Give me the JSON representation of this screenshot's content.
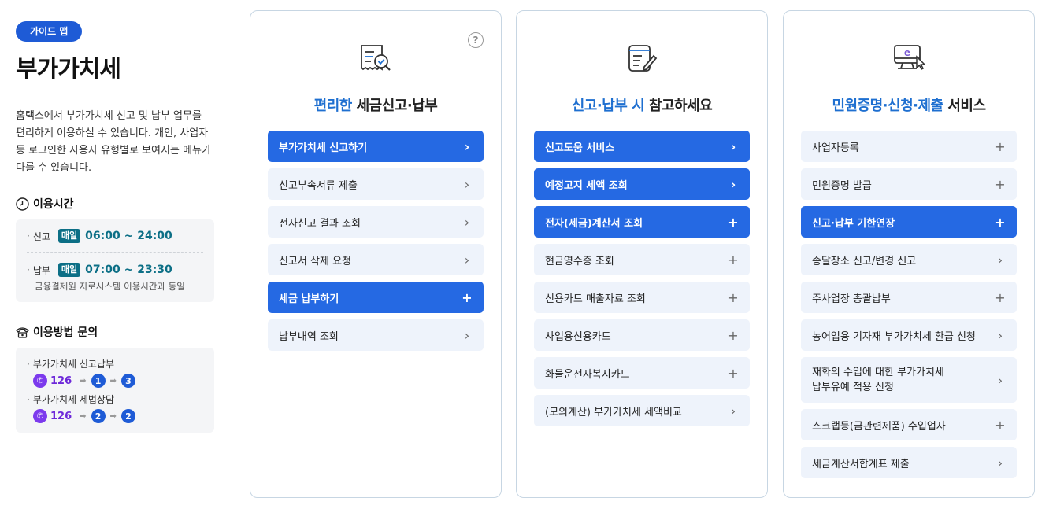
{
  "left": {
    "badge": "가이드 맵",
    "title": "부가가치세",
    "description": "홈택스에서 부가가치세 신고 및 납부 업무를 편리하게 이용하실 수 있습니다. 개인, 사업자 등 로그인한 사용자 유형별로 보여지는 메뉴가 다를 수 있습니다.",
    "hours": {
      "title": "이용시간",
      "report_label": "신고",
      "report_badge": "매일",
      "report_time": "06:00 ~ 24:00",
      "pay_label": "납부",
      "pay_badge": "매일",
      "pay_time": "07:00 ~ 23:30",
      "pay_note": "금융결제원 지로시스템 이용시간과 동일"
    },
    "inquiry": {
      "title": "이용방법 문의",
      "items": [
        {
          "label": "부가가치세 신고납부",
          "phone": "126",
          "step1": "1",
          "step2": "3"
        },
        {
          "label": "부가가치세 세법상담",
          "phone": "126",
          "step1": "2",
          "step2": "2"
        }
      ]
    }
  },
  "cards": [
    {
      "title_accent": "편리한",
      "title_rest": " 세금신고·납부",
      "items": [
        {
          "label": "부가가치세 신고하기",
          "icon": "chevron-right",
          "active": true
        },
        {
          "label": "신고부속서류 제출",
          "icon": "chevron-right",
          "active": false
        },
        {
          "label": "전자신고 결과 조회",
          "icon": "chevron-right",
          "active": false
        },
        {
          "label": "신고서 삭제 요청",
          "icon": "chevron-right",
          "active": false
        },
        {
          "label": "세금 납부하기",
          "icon": "plus",
          "active": true
        },
        {
          "label": "납부내역 조회",
          "icon": "chevron-right",
          "active": false
        }
      ]
    },
    {
      "title_accent": "신고·납부 시",
      "title_rest": " 참고하세요",
      "items": [
        {
          "label": "신고도움 서비스",
          "icon": "chevron-right",
          "active": true
        },
        {
          "label": "예정고지 세액 조회",
          "icon": "chevron-right",
          "active": true
        },
        {
          "label": "전자(세금)계산서 조회",
          "icon": "plus",
          "active": true
        },
        {
          "label": "현금영수증 조회",
          "icon": "plus",
          "active": false
        },
        {
          "label": "신용카드 매출자료 조회",
          "icon": "plus",
          "active": false
        },
        {
          "label": "사업용신용카드",
          "icon": "plus",
          "active": false
        },
        {
          "label": "화물운전자복지카드",
          "icon": "plus",
          "active": false
        },
        {
          "label": "(모의계산) 부가가치세 세액비교",
          "icon": "chevron-right",
          "active": false
        }
      ]
    },
    {
      "title_accent": "민원증명·신청·제출",
      "title_rest": " 서비스",
      "items": [
        {
          "label": "사업자등록",
          "icon": "plus",
          "active": false
        },
        {
          "label": "민원증명 발급",
          "icon": "plus",
          "active": false
        },
        {
          "label": "신고·납부 기한연장",
          "icon": "plus",
          "active": true
        },
        {
          "label": "송달장소 신고/변경 신고",
          "icon": "chevron-right",
          "active": false
        },
        {
          "label": "주사업장 총괄납부",
          "icon": "plus",
          "active": false
        },
        {
          "label": "농어업용 기자재 부가가치세 환급 신청",
          "icon": "chevron-right",
          "active": false
        },
        {
          "label": "재화의 수입에 대한 부가가치세\n납부유예 적용 신청",
          "icon": "chevron-right",
          "active": false,
          "tall": true
        },
        {
          "label": "스크랩등(금관련제품) 수입업자",
          "icon": "plus",
          "active": false
        },
        {
          "label": "세금계산서합계표 제출",
          "icon": "chevron-right",
          "active": false
        }
      ]
    }
  ]
}
